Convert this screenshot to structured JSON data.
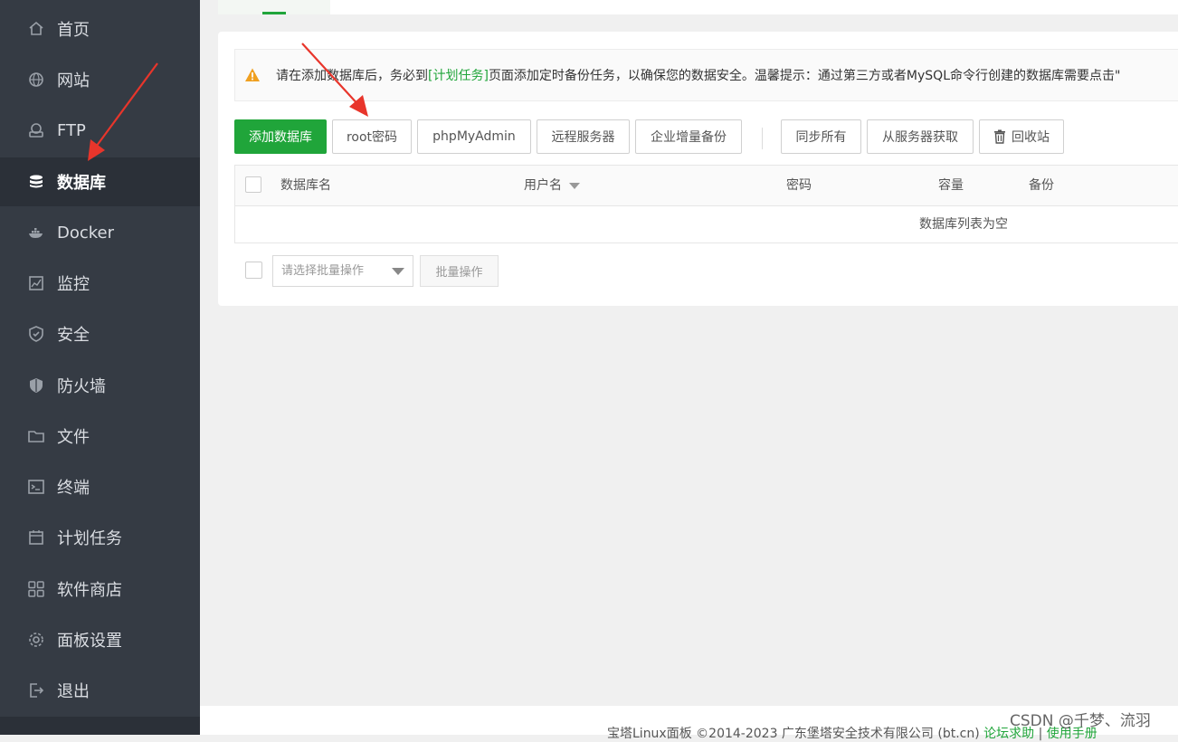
{
  "sidebar": {
    "items": [
      {
        "label": "首页",
        "icon": "home-icon"
      },
      {
        "label": "网站",
        "icon": "globe-icon"
      },
      {
        "label": "FTP",
        "icon": "ftp-icon"
      },
      {
        "label": "数据库",
        "icon": "database-icon",
        "active": true
      },
      {
        "label": "Docker",
        "icon": "docker-icon"
      },
      {
        "label": "监控",
        "icon": "monitor-icon"
      },
      {
        "label": "安全",
        "icon": "shield-icon"
      },
      {
        "label": "防火墙",
        "icon": "firewall-icon"
      },
      {
        "label": "文件",
        "icon": "folder-icon"
      },
      {
        "label": "终端",
        "icon": "terminal-icon"
      },
      {
        "label": "计划任务",
        "icon": "calendar-icon"
      },
      {
        "label": "软件商店",
        "icon": "apps-icon"
      },
      {
        "label": "面板设置",
        "icon": "gear-icon"
      },
      {
        "label": "退出",
        "icon": "logout-icon"
      }
    ]
  },
  "notice": {
    "before": "请在添加数据库后，务必到",
    "link": "[计划任务]",
    "after": "页面添加定时备份任务，以确保您的数据安全。温馨提示：通过第三方或者MySQL命令行创建的数据库需要点击\"",
    "icon": "warning-icon"
  },
  "toolbar": {
    "add_database": "添加数据库",
    "root_password": "root密码",
    "phpmyadmin": "phpMyAdmin",
    "remote_server": "远程服务器",
    "enterprise_backup": "企业增量备份",
    "sync_all": "同步所有",
    "fetch_from_server": "从服务器获取",
    "recycle_bin": "回收站"
  },
  "table": {
    "columns": [
      "数据库名",
      "用户名",
      "密码",
      "容量",
      "备份"
    ],
    "empty_text": "数据库列表为空"
  },
  "batch": {
    "select_placeholder": "请选择批量操作",
    "button": "批量操作"
  },
  "footer": {
    "copyright": "宝塔Linux面板 ©2014-2023 广东堡塔安全技术有限公司 (bt.cn)",
    "forum": "论坛求助",
    "manual": "使用手册"
  },
  "watermark": "CSDN @千梦、流羽",
  "colors": {
    "sidebar_bg": "#353b44",
    "primary_green": "#20a53a",
    "annotation_red": "#e8352b",
    "warning_orange": "#f0a020"
  }
}
